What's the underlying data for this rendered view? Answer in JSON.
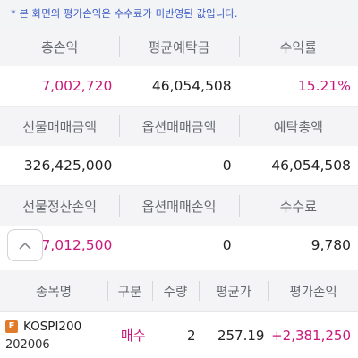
{
  "notice": "* 본 화면의 평가손익은 수수료가 미반영된 값입니다.",
  "summary": {
    "row1": {
      "headers": [
        "총손익",
        "평균예탁금",
        "수익률"
      ],
      "values": [
        "7,002,720",
        "46,054,508",
        "15.21%"
      ]
    },
    "row2": {
      "headers": [
        "선물매매금액",
        "옵션매매금액",
        "예탁총액"
      ],
      "values": [
        "326,425,000",
        "0",
        "46,054,508"
      ]
    },
    "row3": {
      "headers": [
        "선물정산손익",
        "옵션매매손익",
        "수수료"
      ],
      "values": [
        "7,012,500",
        "0",
        "9,780"
      ]
    }
  },
  "colors": {
    "profit": "#c9187a",
    "notice": "#3f5ec7",
    "badge": "#e07b2a"
  },
  "up_button": {
    "icon": "chevron-up-icon",
    "glyph": "︿"
  },
  "table": {
    "headers": [
      "종목명",
      "구분",
      "수량",
      "평균가",
      "평가손익"
    ],
    "rows": [
      {
        "badge": "F",
        "symbol": "KOSPI200",
        "expiry": "202006",
        "side": "매수",
        "qty": "2",
        "avg_price": "257.19",
        "pnl": "+2,381,250"
      }
    ]
  }
}
